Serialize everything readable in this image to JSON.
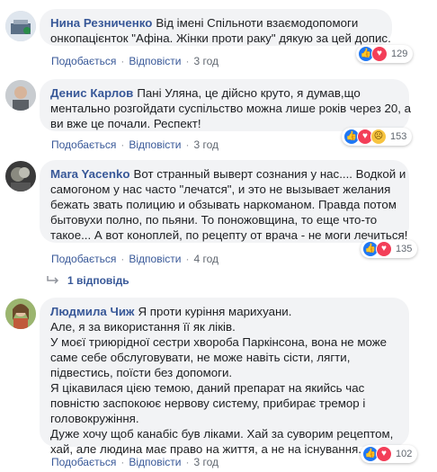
{
  "colors": {
    "author": "#385898",
    "bubble_bg": "#f2f3f5",
    "meta": "#606770",
    "like": "#2078f4",
    "love": "#f33e58",
    "wow": "#f7c440"
  },
  "comments": [
    {
      "author": "Нина Резниченко",
      "lines": [
        "Від імені Спільноти взаємодопомоги",
        "онкопацієнток \"Афіна. Жінки проти раку\" дякую за цей допис."
      ],
      "actions": {
        "like": "Подобається",
        "reply": "Відповісти",
        "time": "3 год"
      },
      "reactions": {
        "icons": [
          "like-icon",
          "love-icon"
        ],
        "count": "129"
      }
    },
    {
      "author": "Денис Карлов",
      "lines": [
        "Пані Уляна, це дійсно круто, я думав,що",
        "ментально розгойдати суспільство можна лише років через 20, а",
        "ви вже це почали. Респект!"
      ],
      "actions": {
        "like": "Подобається",
        "reply": "Відповісти",
        "time": "3 год"
      },
      "reactions": {
        "icons": [
          "like-icon",
          "love-icon",
          "wow-icon"
        ],
        "count": "153"
      }
    },
    {
      "author": "Mara Yacenko",
      "lines": [
        "Вот странный выверт сознания у нас.... Водкой и",
        "самогоном у нас часто \"лечатся\", и это не вызывает желания",
        "бежать звать полицию и обзывать наркоманом. Правда потом",
        "бытовухи полно, по пьяни. То поножовщина, то еще что-то",
        "такое... А вот коноплей, по рецепту от врача - не моги лечиться!"
      ],
      "actions": {
        "like": "Подобається",
        "reply": "Відповісти",
        "time": "4 год"
      },
      "reactions": {
        "icons": [
          "like-icon",
          "love-icon"
        ],
        "count": "135"
      },
      "replies": "1 відповідь"
    },
    {
      "author": "Людмила Чиж",
      "lines": [
        "Я проти куріння марихуани.",
        "Але, я за використання її як ліків.",
        "У моєї триюрідної сестри хвороба Паркінсона, вона не може",
        "саме себе обслуговувати, не може навіть сісти, лягти,",
        "підвестись, поїсти без допомоги.",
        "Я цікавилася цією темою, даний препарат на якийсь час",
        "повністю заспокоює нервову систему, прибирає тремор і",
        "головокружіння.",
        "Дуже хочу щоб канабіс був ліками. Хай за суворим рецептом,",
        "хай, але людина має право на життя, а не на існування."
      ],
      "actions": {
        "like": "Подобається",
        "reply": "Відповісти",
        "time": "3 год"
      },
      "reactions": {
        "icons": [
          "like-icon",
          "love-icon"
        ],
        "count": "102"
      }
    }
  ]
}
